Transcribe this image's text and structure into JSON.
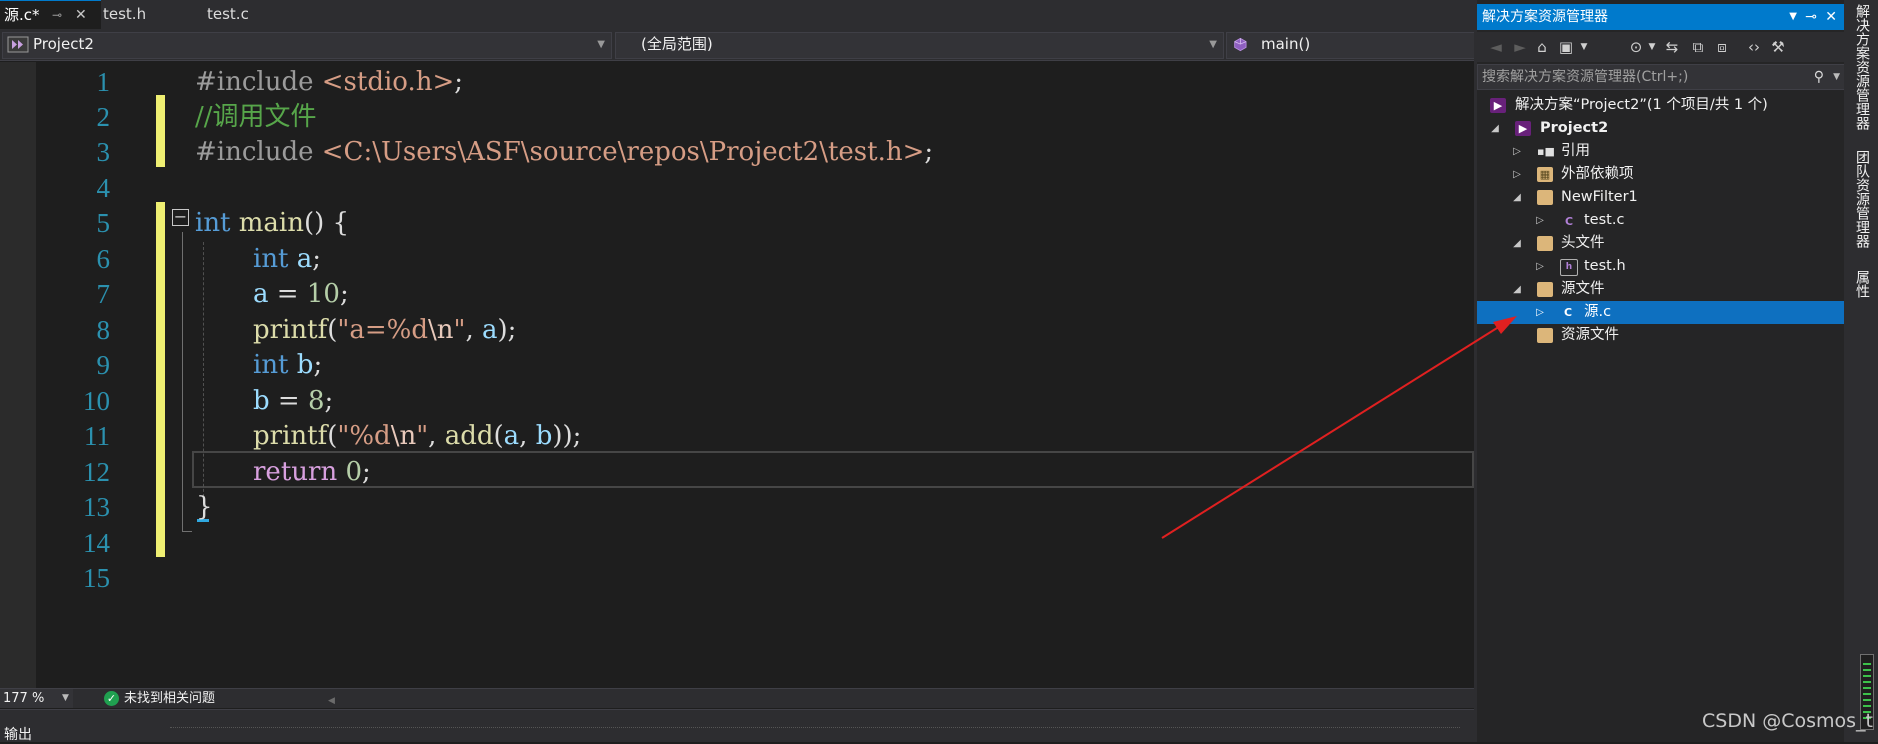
{
  "tabs": [
    {
      "label": "源.c*",
      "active": true
    },
    {
      "label": "test.h",
      "active": false
    },
    {
      "label": "test.c",
      "active": false
    }
  ],
  "tab_controls": {
    "pin": "⊸",
    "close": "✕"
  },
  "navbar": {
    "project": "Project2",
    "scope": "(全局范围)",
    "member": "main()"
  },
  "code": {
    "line_numbers": [
      "1",
      "2",
      "3",
      "4",
      "5",
      "6",
      "7",
      "8",
      "9",
      "10",
      "11",
      "12",
      "13",
      "14",
      "15"
    ],
    "lines": {
      "l1": {
        "directive": "#include ",
        "path": "<stdio.h>",
        "end": ";"
      },
      "l2": {
        "comment": "//调用文件"
      },
      "l3": {
        "directive": "#include ",
        "path": "<C:\\Users\\ASF\\source\\repos\\Project2\\test.h>",
        "end": ";"
      },
      "l5": {
        "type": "int",
        "name": " main",
        "rest": "() {"
      },
      "l6": {
        "type": "int",
        "var": " a",
        "end": ";"
      },
      "l7": {
        "var": "a",
        "op": " = ",
        "num": "10",
        "end": ";"
      },
      "l8": {
        "fn": "printf",
        "open": "(",
        "str1": "\"a=%d",
        "esc": "\\n",
        "str2": "\"",
        "mid": ", ",
        "var": "a",
        "end": ");"
      },
      "l9": {
        "type": "int",
        "var": " b",
        "end": ";"
      },
      "l10": {
        "var": "b",
        "op": " = ",
        "num": "8",
        "end": ";"
      },
      "l11": {
        "fn": "printf",
        "open": "(",
        "str1": "\"%d",
        "esc": "\\n",
        "str2": "\"",
        "mid": ", ",
        "fn2": "add",
        "open2": "(",
        "v1": "a",
        "comma": ", ",
        "v2": "b",
        "end": "));"
      },
      "l12": {
        "kw": "return",
        "sp": " ",
        "num": "0",
        "end": ";"
      },
      "l13": {
        "brace": "}"
      }
    }
  },
  "status": {
    "zoom": "177 %",
    "issues": "未找到相关问题",
    "ok_glyph": "✓"
  },
  "output_panel": {
    "label": "输出"
  },
  "solution_explorer": {
    "title": "解决方案资源管理器",
    "search_placeholder": "搜索解决方案资源管理器(Ctrl+;)",
    "tree": [
      {
        "label": "解决方案“Project2”(1 个项目/共 1 个)",
        "icon": "solution-icon"
      },
      {
        "label": "Project2",
        "icon": "project-icon"
      },
      {
        "label": "引用",
        "icon": "references-icon"
      },
      {
        "label": "外部依赖项",
        "icon": "external-deps-icon"
      },
      {
        "label": "NewFilter1",
        "icon": "folder-icon"
      },
      {
        "label": "test.c",
        "icon": "c-file-icon"
      },
      {
        "label": "头文件",
        "icon": "folder-icon"
      },
      {
        "label": "test.h",
        "icon": "h-file-icon"
      },
      {
        "label": "源文件",
        "icon": "folder-icon"
      },
      {
        "label": "源.c",
        "icon": "c-file-icon",
        "selected": true
      },
      {
        "label": "资源文件",
        "icon": "folder-icon"
      }
    ]
  },
  "side_tabs": [
    "解决方案资源管理器",
    "团队资源管理器",
    "属性"
  ],
  "watermark": "CSDN @Cosmos_t",
  "colors": {
    "accent": "#007acc",
    "selection": "#0e70c0",
    "change_marker": "#efef72",
    "arrow": "#e02020"
  }
}
